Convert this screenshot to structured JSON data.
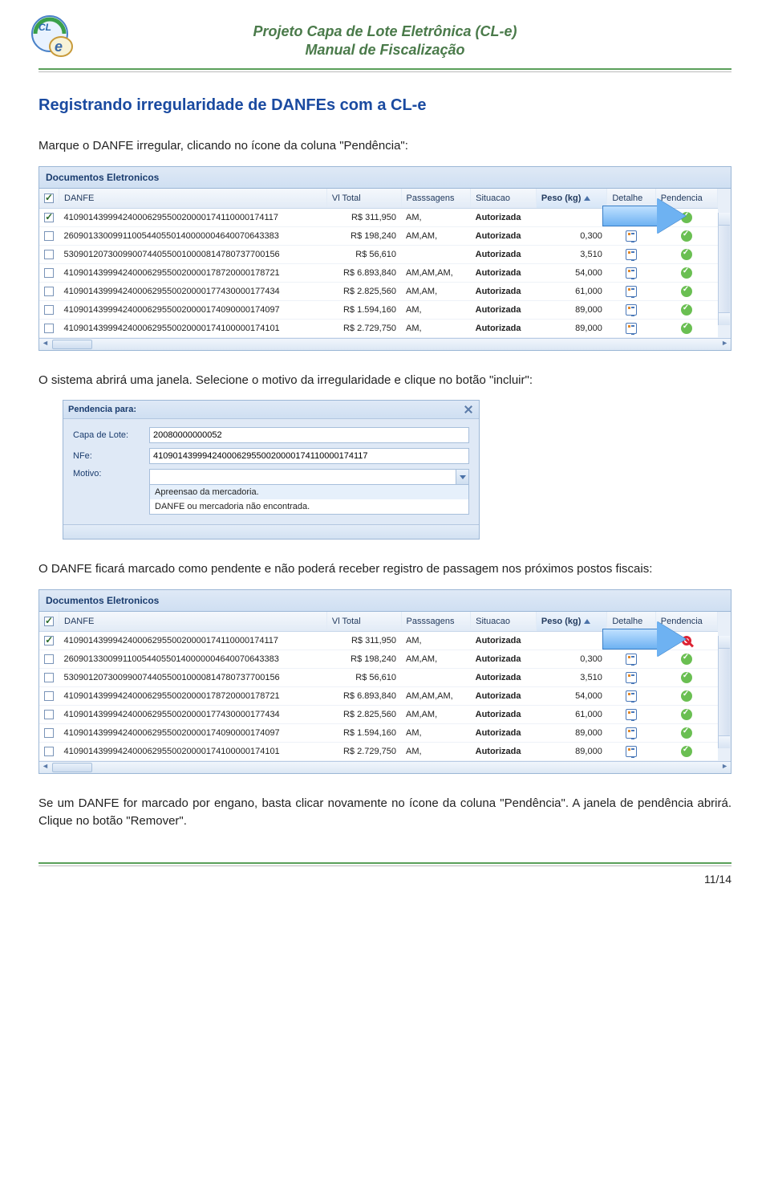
{
  "doc": {
    "title_line1": "Projeto Capa de Lote Eletrônica (CL-e)",
    "title_line2": "Manual de Fiscalização",
    "page_number": "11/14"
  },
  "section_title": "Registrando irregularidade de DANFEs com a CL-e",
  "paragraphs": {
    "p1": "Marque o DANFE irregular, clicando no ícone da coluna \"Pendência\":",
    "p2": "O sistema abrirá uma janela. Selecione o motivo da irregularidade e clique no botão \"incluir\":",
    "p3": "O DANFE ficará marcado como pendente e não poderá receber registro de passagem nos próximos postos fiscais:",
    "p4": "Se um DANFE for marcado por engano, basta clicar novamente no ícone da coluna \"Pendência\". A janela de pendência abrirá.  Clique no botão \"Remover\"."
  },
  "grid": {
    "panel_title": "Documentos Eletronicos",
    "headers": {
      "chk": "",
      "danfe": "DANFE",
      "vl_total": "Vl Total",
      "passagens": "Passsagens",
      "situacao": "Situacao",
      "peso": "Peso (kg)",
      "detalhe": "Detalhe",
      "pendencia": "Pendencia"
    },
    "rows": [
      {
        "chk": true,
        "danfe": "41090143999424000629550020000174110000174117",
        "vl": "R$ 311,950",
        "pass": "AM,",
        "sit": "Autorizada",
        "peso": "",
        "det": true,
        "pend": "ok"
      },
      {
        "chk": false,
        "danfe": "26090133009911005440550140000004640070643383",
        "vl": "R$ 198,240",
        "pass": "AM,AM,",
        "sit": "Autorizada",
        "peso": "0,300",
        "det": true,
        "pend": "ok"
      },
      {
        "chk": false,
        "danfe": "53090120730099007440550010000814780737700156",
        "vl": "R$ 56,610",
        "pass": "",
        "sit": "Autorizada",
        "peso": "3,510",
        "det": true,
        "pend": "ok"
      },
      {
        "chk": false,
        "danfe": "41090143999424000629550020000178720000178721",
        "vl": "R$ 6.893,840",
        "pass": "AM,AM,AM,",
        "sit": "Autorizada",
        "peso": "54,000",
        "det": true,
        "pend": "ok"
      },
      {
        "chk": false,
        "danfe": "41090143999424000629550020000177430000177434",
        "vl": "R$ 2.825,560",
        "pass": "AM,AM,",
        "sit": "Autorizada",
        "peso": "61,000",
        "det": true,
        "pend": "ok"
      },
      {
        "chk": false,
        "danfe": "41090143999424000629550020000174090000174097",
        "vl": "R$ 1.594,160",
        "pass": "AM,",
        "sit": "Autorizada",
        "peso": "89,000",
        "det": true,
        "pend": "ok"
      },
      {
        "chk": false,
        "danfe": "41090143999424000629550020000174100000174101",
        "vl": "R$ 2.729,750",
        "pass": "AM,",
        "sit": "Autorizada",
        "peso": "89,000",
        "det": true,
        "pend": "ok"
      }
    ],
    "first_row_pendencia_blocked": "block"
  },
  "dialog": {
    "title": "Pendencia para:",
    "labels": {
      "capa": "Capa de Lote:",
      "nfe": "NFe:",
      "motivo": "Motivo:"
    },
    "values": {
      "capa": "20080000000052",
      "nfe": "41090143999424000629550020000174110000174117",
      "motivo": ""
    },
    "options": [
      "Apreensao da mercadoria.",
      "DANFE ou mercadoria não encontrada."
    ]
  }
}
